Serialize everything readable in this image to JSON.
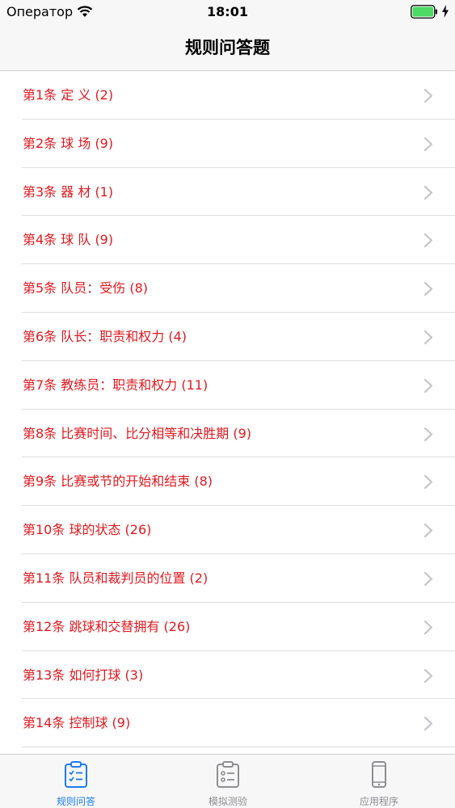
{
  "status_bar": {
    "carrier": "Оператор",
    "time": "18:01"
  },
  "nav": {
    "title": "规则问答题"
  },
  "articles": [
    "第1条 定 义 (2)",
    "第2条 球 场 (9)",
    "第3条 器 材 (1)",
    "第4条 球 队 (9)",
    "第5条 队员：受伤 (8)",
    "第6条 队长：职责和权力 (4)",
    "第7条 教练员：职责和权力 (11)",
    "第8条 比赛时间、比分相等和决胜期 (9)",
    "第9条 比赛或节的开始和结束 (8)",
    "第10条 球的状态 (26)",
    "第11条 队员和裁判员的位置 (2)",
    "第12条 跳球和交替拥有 (26)",
    "第13条 如何打球 (3)",
    "第14条 控制球 (9)"
  ],
  "tabs": [
    {
      "label": "规则问答",
      "icon": "clipboard-checklist-icon",
      "active": true
    },
    {
      "label": "模拟测验",
      "icon": "clipboard-list-icon",
      "active": false
    },
    {
      "label": "应用程序",
      "icon": "phone-icon",
      "active": false
    }
  ],
  "colors": {
    "accent": "#1b7cf2",
    "row_text": "#e0191f",
    "inactive": "#8e8e93"
  }
}
